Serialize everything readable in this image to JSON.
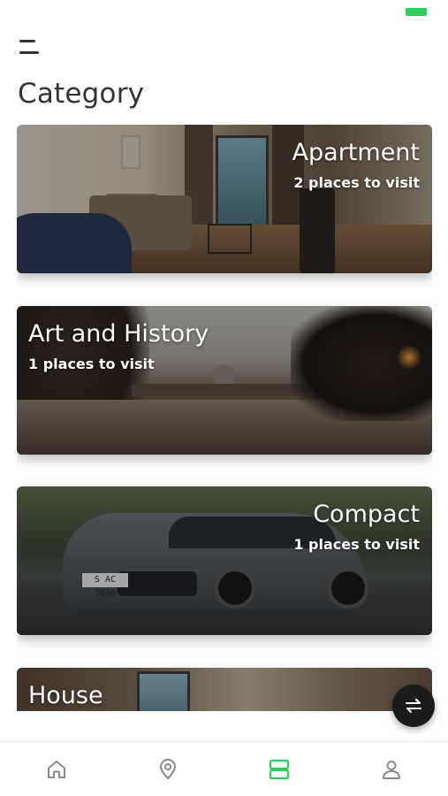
{
  "header": {
    "title": "Category"
  },
  "categories": [
    {
      "name": "Apartment",
      "subtitle": "2 places to visit"
    },
    {
      "name": "Art and History",
      "subtitle": "1 places to visit"
    },
    {
      "name": "Compact",
      "subtitle": "1 places to visit"
    },
    {
      "name": "House",
      "subtitle": ""
    }
  ],
  "car_plate": "S AC 7036",
  "bottom_nav": {
    "active": "categories",
    "items": [
      "home",
      "location",
      "categories",
      "profile"
    ]
  },
  "colors": {
    "accent": "#2fcf5e",
    "nav_inactive": "#8a8a8a",
    "fab": "#1b1b1b"
  },
  "icons": {
    "menu": "menu-icon",
    "fab": "swap-arrows-icon",
    "home": "home-icon",
    "location": "map-pin-icon",
    "categories": "categories-icon",
    "profile": "user-icon"
  }
}
